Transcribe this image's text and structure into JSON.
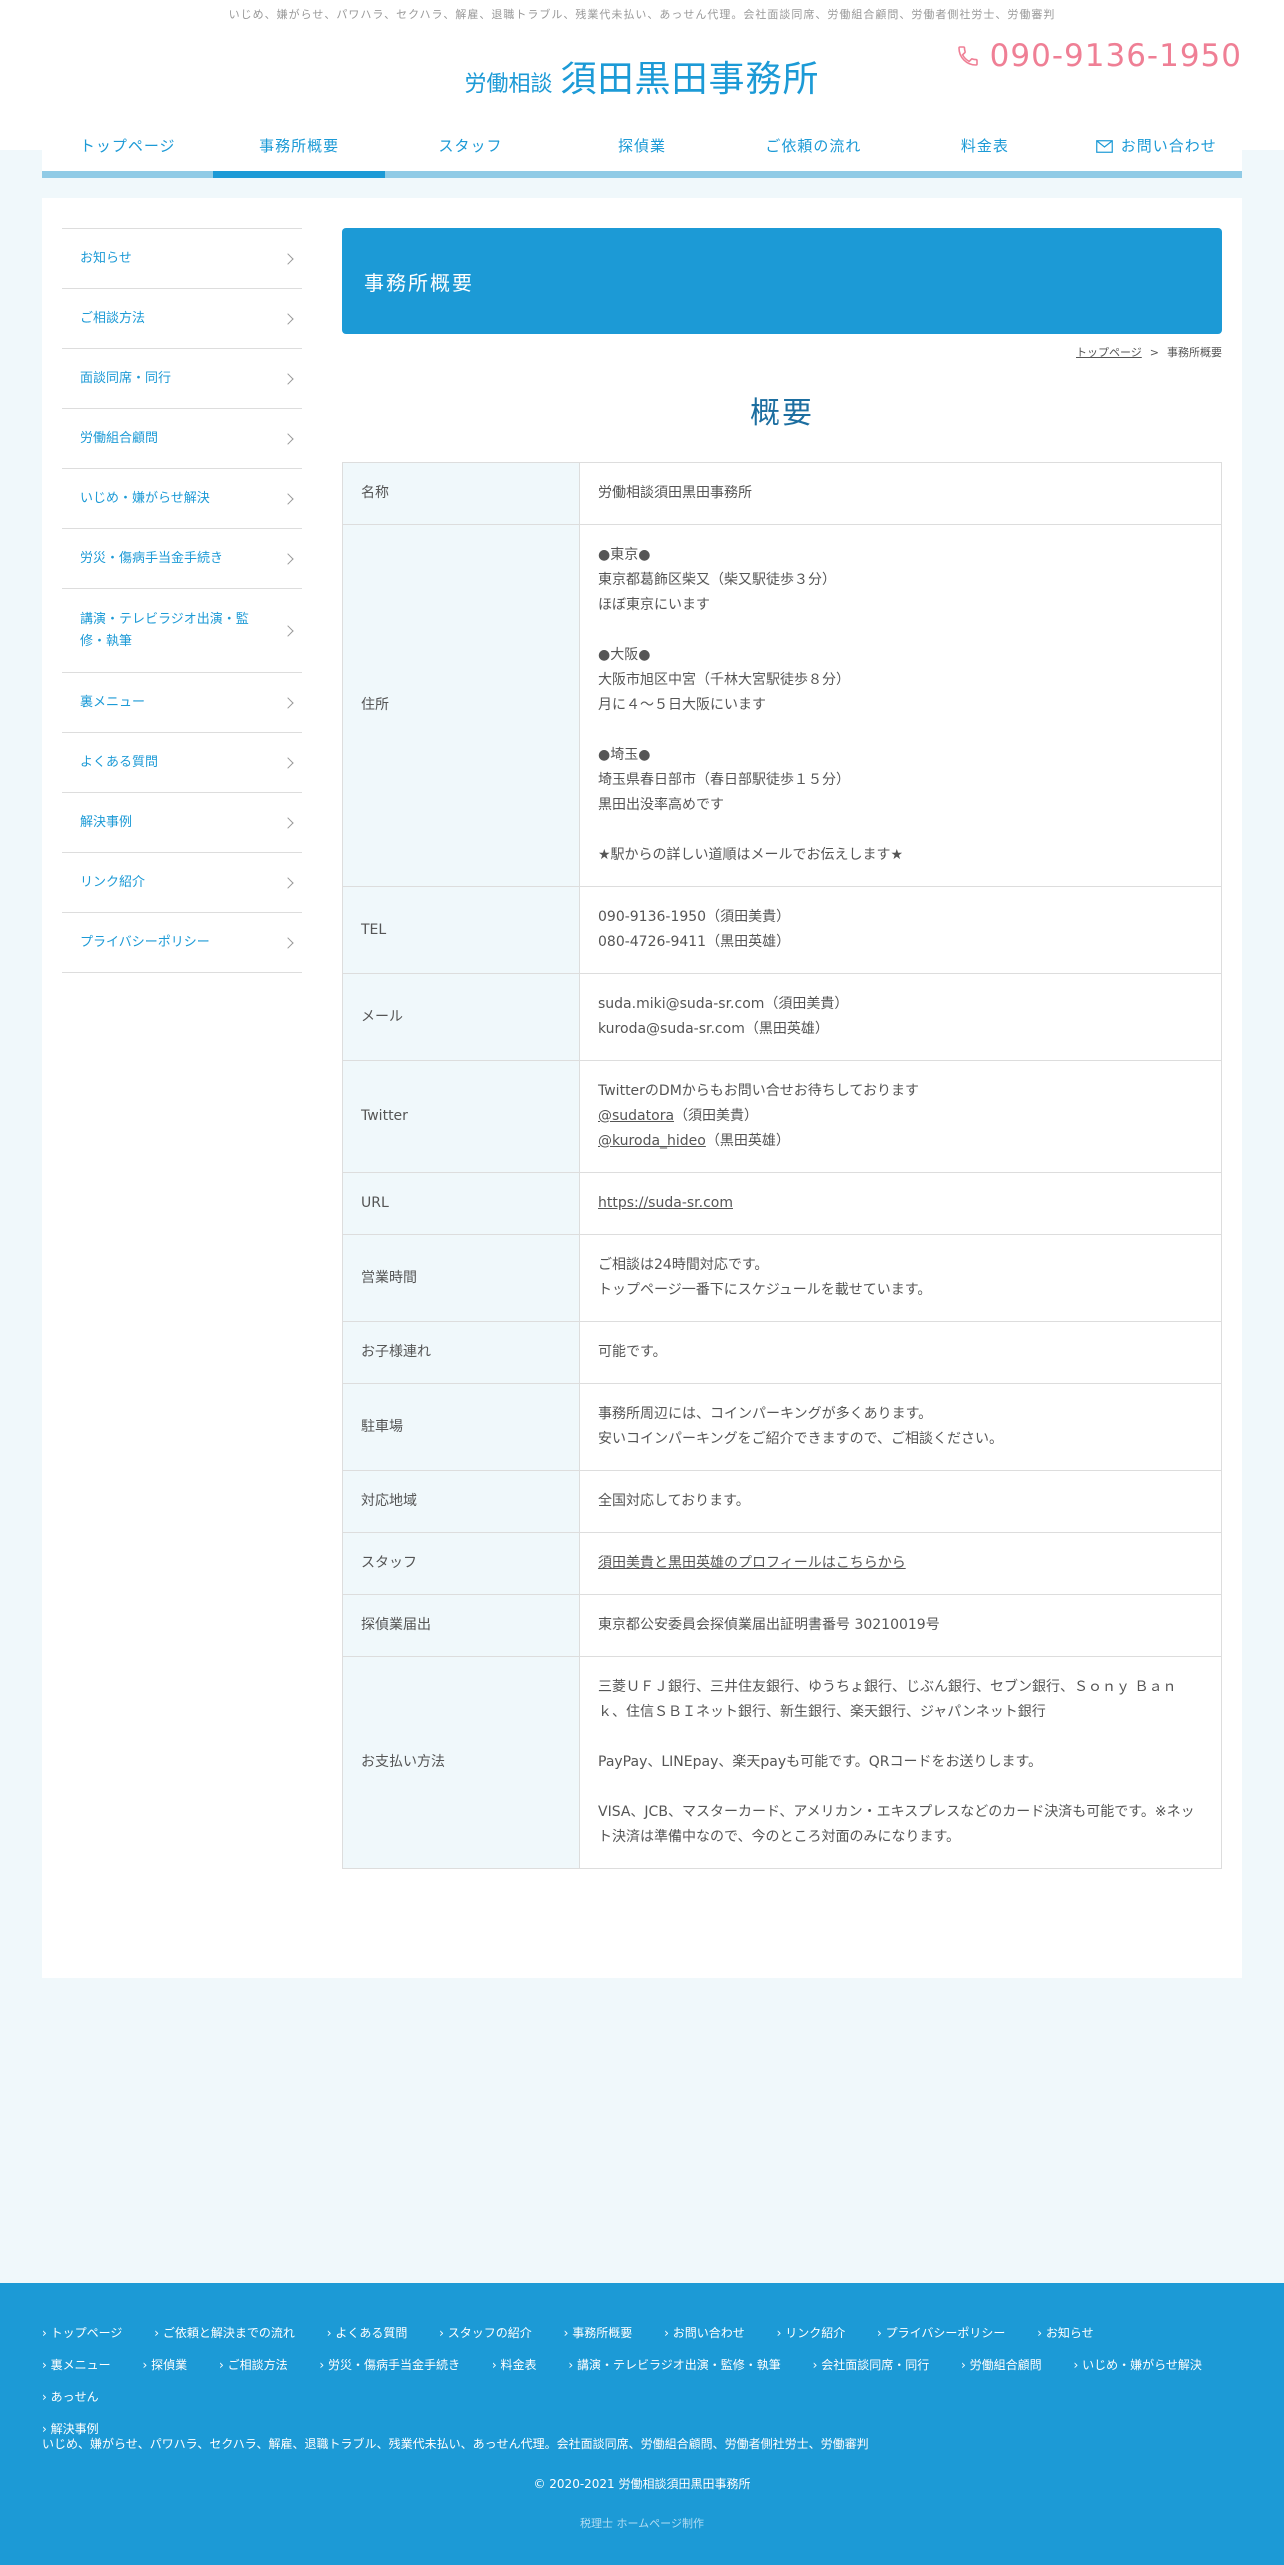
{
  "header": {
    "tagline": "いじめ、嫌がらせ、パワハラ、セクハラ、解雇、退職トラブル、残業代未払い、あっせん代理。会社面談同席、労働組合顧問、労働者側社労士、労働審判",
    "logo_small": "労働相談",
    "logo_big": "須田黒田事務所",
    "phone": "090-9136-1950"
  },
  "nav": {
    "items": [
      {
        "label": "トップページ"
      },
      {
        "label": "事務所概要"
      },
      {
        "label": "スタッフ"
      },
      {
        "label": "探偵業"
      },
      {
        "label": "ご依頼の流れ"
      },
      {
        "label": "料金表"
      },
      {
        "label": "お問い合わせ"
      }
    ]
  },
  "sidebar": {
    "items": [
      {
        "label": "お知らせ"
      },
      {
        "label": "ご相談方法"
      },
      {
        "label": "面談同席・同行"
      },
      {
        "label": "労働組合顧問"
      },
      {
        "label": "いじめ・嫌がらせ解決"
      },
      {
        "label": "労災・傷病手当金手続き"
      },
      {
        "label": "講演・テレビラジオ出演・監修・執筆"
      },
      {
        "label": "裏メニュー"
      },
      {
        "label": "よくある質問"
      },
      {
        "label": "解決事例"
      },
      {
        "label": "リンク紹介"
      },
      {
        "label": "プライバシーポリシー"
      }
    ]
  },
  "page": {
    "banner_title": "事務所概要",
    "breadcrumb_home": "トップページ",
    "breadcrumb_sep": ">",
    "breadcrumb_current": "事務所概要",
    "section_title": "概要"
  },
  "table": {
    "name_label": "名称",
    "name_value": "労働相談須田黒田事務所",
    "address_label": "住所",
    "address": {
      "tokyo_head": "●東京●",
      "tokyo_addr": "東京都葛飾区柴又（柴又駅徒歩３分）",
      "tokyo_note": "ほぼ東京にいます",
      "osaka_head": "●大阪●",
      "osaka_addr": "大阪市旭区中宮（千林大宮駅徒歩８分）",
      "osaka_note": "月に４～５日大阪にいます",
      "saitama_head": "●埼玉●",
      "saitama_addr": "埼玉県春日部市（春日部駅徒歩１５分）",
      "saitama_note": "黒田出没率高めです",
      "directions": "★駅からの詳しい道順はメールでお伝えします★"
    },
    "tel_label": "TEL",
    "tel_1": "090-9136-1950（須田美貴）",
    "tel_2": "080-4726-9411（黒田英雄）",
    "mail_label": "メール",
    "mail_1": "suda.miki@suda-sr.com（須田美貴）",
    "mail_2": "kuroda@suda-sr.com（黒田英雄）",
    "twitter_label": "Twitter",
    "twitter_note": "TwitterのDMからもお問い合せお待ちしております",
    "twitter_1_handle": "@sudatora",
    "twitter_1_name": "（須田美貴）",
    "twitter_2_handle": "@kuroda_hideo",
    "twitter_2_name": "（黒田英雄）",
    "url_label": "URL",
    "url_value": "https://suda-sr.com",
    "hours_label": "営業時間",
    "hours_1": "ご相談は24時間対応です。",
    "hours_2": "トップページ一番下にスケジュールを載せています。",
    "kids_label": "お子様連れ",
    "kids_value": "可能です。",
    "parking_label": "駐車場",
    "parking_1": "事務所周辺には、コインパーキングが多くあります。",
    "parking_2": "安いコインパーキングをご紹介できますので、ご相談ください。",
    "area_label": "対応地域",
    "area_value": "全国対応しております。",
    "staff_label": "スタッフ",
    "staff_link": "須田美貴と黒田英雄のプロフィールはこちらから",
    "detective_label": "探偵業届出",
    "detective_value": "東京都公安委員会探偵業届出証明書番号 30210019号",
    "payment_label": "お支払い方法",
    "payment_1": "三菱ＵＦＪ銀行、三井住友銀行、ゆうちょ銀行、じぶん銀行、セブン銀行、Ｓｏｎｙ Ｂａｎｋ、住信ＳＢＩネット銀行、新生銀行、楽天銀行、ジャパンネット銀行",
    "payment_2": "PayPay、LINEpay、楽天payも可能です。QRコードをお送りします。",
    "payment_3": "VISA、JCB、マスターカード、アメリカン・エキスプレスなどのカード決済も可能です。※ネット決済は準備中なので、今のところ対面のみになります。"
  },
  "footer": {
    "nav": [
      "トップページ",
      "ご依頼と解決までの流れ",
      "よくある質問",
      "スタッフの紹介",
      "事務所概要",
      "お問い合わせ",
      "リンク紹介",
      "プライバシーポリシー",
      "お知らせ",
      "裏メニュー",
      "探偵業",
      "ご相談方法",
      "労災・傷病手当金手続き",
      "料金表",
      "講演・テレビラジオ出演・監修・執筆",
      "会社面談同席・同行",
      "労働組合顧問",
      "いじめ・嫌がらせ解決",
      "あっせん",
      "解決事例"
    ],
    "tagline": "いじめ、嫌がらせ、パワハラ、セクハラ、解雇、退職トラブル、残業代未払い、あっせん代理。会社面談同席、労働組合顧問、労働者側社労士、労働審判",
    "copyright": "© 2020-2021 労働相談須田黒田事務所",
    "credit": "税理士 ホームページ制作"
  }
}
